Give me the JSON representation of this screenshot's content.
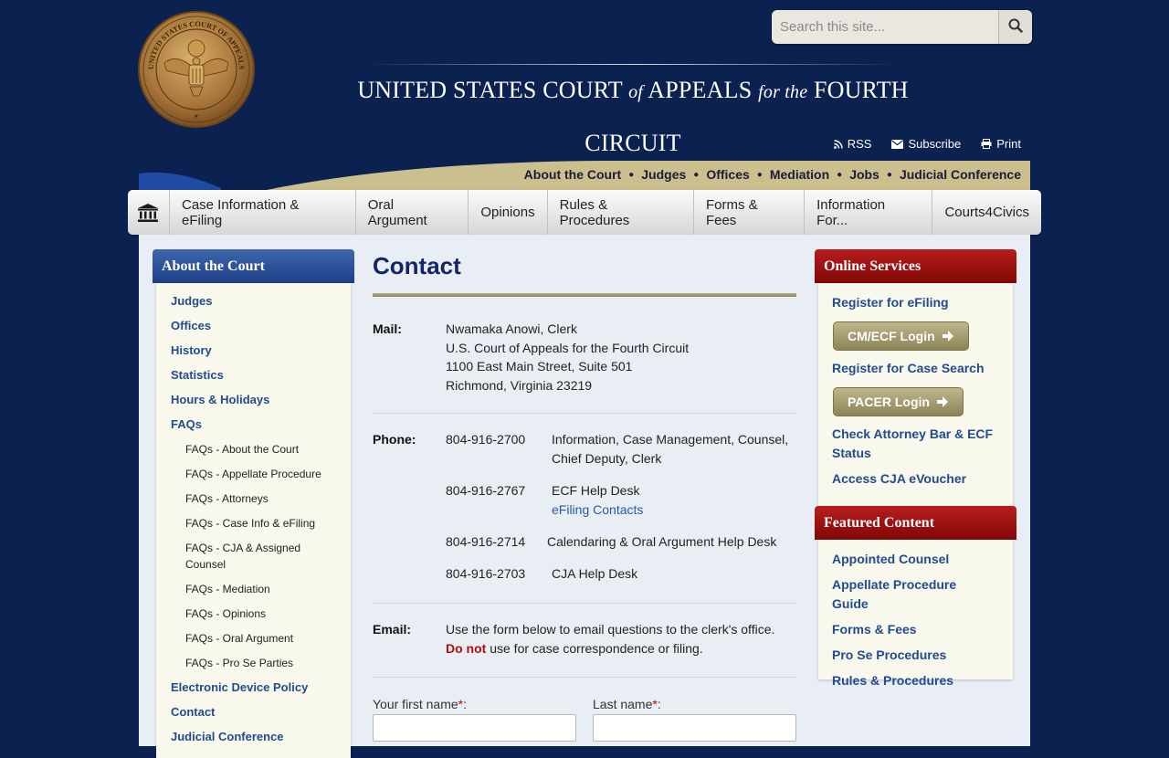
{
  "header": {
    "seal_text_top": "UNITED STATES COURT OF APPEALS",
    "seal_text_bottom": "for the FOURTH CIRCUIT",
    "title_part1": "UNITED STATES COURT",
    "title_of": "of",
    "title_part2": "APPEALS",
    "title_for": "for the",
    "title_part3": "FOURTH CIRCUIT",
    "search_placeholder": "Search this site...",
    "utility": [
      {
        "icon": "rss-icon",
        "label": "RSS"
      },
      {
        "icon": "envelope-icon",
        "label": "Subscribe"
      },
      {
        "icon": "printer-icon",
        "label": "Print"
      }
    ]
  },
  "secondary_nav": [
    "About the Court",
    "Judges",
    "Offices",
    "Mediation",
    "Jobs",
    "Judicial Conference"
  ],
  "main_nav": [
    "Case Information & eFiling",
    "Oral Argument",
    "Opinions",
    "Rules & Procedures",
    "Forms & Fees",
    "Information For...",
    "Courts4Civics"
  ],
  "left_sidebar": {
    "title": "About the Court",
    "links": [
      {
        "label": "Judges",
        "sub": false
      },
      {
        "label": "Offices",
        "sub": false
      },
      {
        "label": "History",
        "sub": false
      },
      {
        "label": "Statistics",
        "sub": false
      },
      {
        "label": "Hours & Holidays",
        "sub": false
      },
      {
        "label": "FAQs",
        "sub": false
      },
      {
        "label": "FAQs - About the Court",
        "sub": true
      },
      {
        "label": "FAQs - Appellate Procedure",
        "sub": true
      },
      {
        "label": "FAQs - Attorneys",
        "sub": true
      },
      {
        "label": "FAQs - Case Info & eFiling",
        "sub": true
      },
      {
        "label": "FAQs - CJA & Assigned Counsel",
        "sub": true
      },
      {
        "label": "FAQs - Mediation",
        "sub": true
      },
      {
        "label": "FAQs - Opinions",
        "sub": true
      },
      {
        "label": "FAQs - Oral Argument",
        "sub": true
      },
      {
        "label": "FAQs - Pro Se Parties",
        "sub": true
      },
      {
        "label": "Electronic Device Policy",
        "sub": false
      },
      {
        "label": "Contact",
        "sub": false
      },
      {
        "label": "Judicial Conference",
        "sub": false
      }
    ]
  },
  "content": {
    "title": "Contact",
    "mail_label": "Mail:",
    "mail_lines": [
      "Nwamaka Anowi, Clerk",
      "U.S. Court of Appeals for the Fourth Circuit",
      "1100 East Main Street, Suite 501",
      "Richmond, Virginia 23219"
    ],
    "phone_label": "Phone:",
    "phones": [
      {
        "number": "804-916-2700",
        "desc": "Information, Case Management, Counsel, Chief Deputy, Clerk"
      },
      {
        "number": "804-916-2767",
        "desc": "ECF Help Desk",
        "link": "eFiling Contacts"
      },
      {
        "number": "804-916-2714",
        "desc": "Calendaring & Oral Argument Help Desk"
      },
      {
        "number": "804-916-2703",
        "desc": "CJA Help Desk"
      }
    ],
    "email_label": "Email:",
    "email_line1": "Use the form below to email questions to the clerk's office.",
    "email_do_not": "Do not",
    "email_line2_rest": " use for case correspondence or filing.",
    "form_first_name": "Your first name",
    "form_last_name": "Last name",
    "required_mark": "*",
    "label_colon": ":"
  },
  "online_services": {
    "title": "Online Services",
    "register_efiling": "Register for eFiling",
    "cmecf_login": "CM/ECF Login",
    "register_case_search": "Register for Case Search",
    "pacer_login": "PACER Login",
    "check_bar": "Check Attorney Bar & ECF Status",
    "cja_evoucher": "Access CJA eVoucher"
  },
  "featured": {
    "title": "Featured Content",
    "links": [
      "Appointed Counsel",
      "Appellate Procedure Guide",
      "Forms & Fees",
      "Pro Se Procedures",
      "Rules & Procedures"
    ]
  }
}
